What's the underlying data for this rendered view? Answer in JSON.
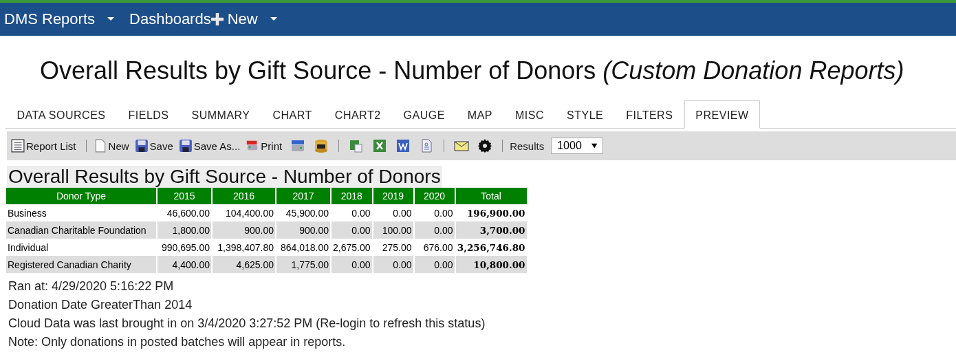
{
  "navbar": {
    "items": [
      {
        "label": "DMS Reports",
        "dropdown": true
      },
      {
        "label": "Dashboards",
        "dropdown": false
      },
      {
        "label": "New",
        "dropdown": true
      }
    ]
  },
  "heading": {
    "title": "Overall Results by Gift Source - Number of Donors",
    "subtitle": "(Custom Donation Reports)"
  },
  "tabs": [
    {
      "label": "DATA SOURCES",
      "selected": false
    },
    {
      "label": "FIELDS",
      "selected": false
    },
    {
      "label": "SUMMARY",
      "selected": false
    },
    {
      "label": "CHART",
      "selected": false
    },
    {
      "label": "CHART2",
      "selected": false
    },
    {
      "label": "GAUGE",
      "selected": false
    },
    {
      "label": "MAP",
      "selected": false
    },
    {
      "label": "MISC",
      "selected": false
    },
    {
      "label": "STYLE",
      "selected": false
    },
    {
      "label": "FILTERS",
      "selected": false
    },
    {
      "label": "PREVIEW",
      "selected": true
    }
  ],
  "toolbar": {
    "buttons": [
      "Report List",
      "New",
      "Save",
      "Save As...",
      "Print"
    ],
    "results_label": "Results",
    "results_value": "1000"
  },
  "report": {
    "title": "Overall Results by Gift Source - Number of Donors",
    "columns": [
      "Donor Type",
      "2015",
      "2016",
      "2017",
      "2018",
      "2019",
      "2020",
      "Total"
    ],
    "rows": [
      [
        "Business",
        "46,600.00",
        "104,400.00",
        "45,900.00",
        "0.00",
        "0.00",
        "0.00",
        "196,900.00"
      ],
      [
        "Canadian Charitable Foundation",
        "1,800.00",
        "900.00",
        "900.00",
        "0.00",
        "100.00",
        "0.00",
        "3,700.00"
      ],
      [
        "Individual",
        "990,695.00",
        "1,398,407.80",
        "864,018.00",
        "2,675.00",
        "275.00",
        "676.00",
        "3,256,746.80"
      ],
      [
        "Registered Canadian Charity",
        "4,400.00",
        "4,625.00",
        "1,775.00",
        "0.00",
        "0.00",
        "0.00",
        "10,800.00"
      ]
    ],
    "notes": [
      "Ran at: 4/29/2020 5:16:22 PM",
      "Donation Date GreaterThan 2014",
      "Cloud Data was last brought in on 3/4/2020 3:27:52 PM (Re-login to refresh this status)",
      "Note: Only donations in posted batches will appear in reports."
    ]
  }
}
